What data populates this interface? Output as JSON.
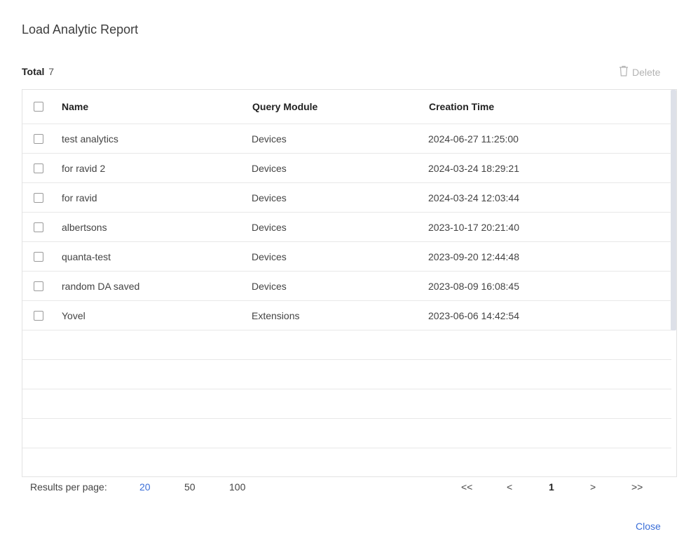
{
  "dialog": {
    "title": "Load Analytic Report"
  },
  "summary": {
    "total_label": "Total",
    "total_count": "7"
  },
  "toolbar": {
    "delete_label": "Delete"
  },
  "table": {
    "columns": [
      "Name",
      "Query Module",
      "Creation Time"
    ],
    "rows": [
      {
        "name": "test analytics",
        "module": "Devices",
        "created": "2024-06-27 11:25:00"
      },
      {
        "name": "for ravid 2",
        "module": "Devices",
        "created": "2024-03-24 18:29:21"
      },
      {
        "name": "for ravid",
        "module": "Devices",
        "created": "2024-03-24 12:03:44"
      },
      {
        "name": "albertsons",
        "module": "Devices",
        "created": "2023-10-17 20:21:40"
      },
      {
        "name": "quanta-test",
        "module": "Devices",
        "created": "2023-09-20 12:44:48"
      },
      {
        "name": "random DA saved",
        "module": "Devices",
        "created": "2023-08-09 16:08:45"
      },
      {
        "name": "Yovel",
        "module": "Extensions",
        "created": "2023-06-06 14:42:54"
      }
    ]
  },
  "pagination": {
    "results_label": "Results per page:",
    "page_sizes": [
      "20",
      "50",
      "100"
    ],
    "selected_size": "20",
    "first": "<<",
    "prev": "<",
    "current_page": "1",
    "next": ">",
    "last": ">>"
  },
  "footer": {
    "close_label": "Close"
  },
  "colors": {
    "accent": "#3a6ed8",
    "disabled": "#b3b3b3"
  },
  "icons": {
    "delete": "trash-icon"
  }
}
